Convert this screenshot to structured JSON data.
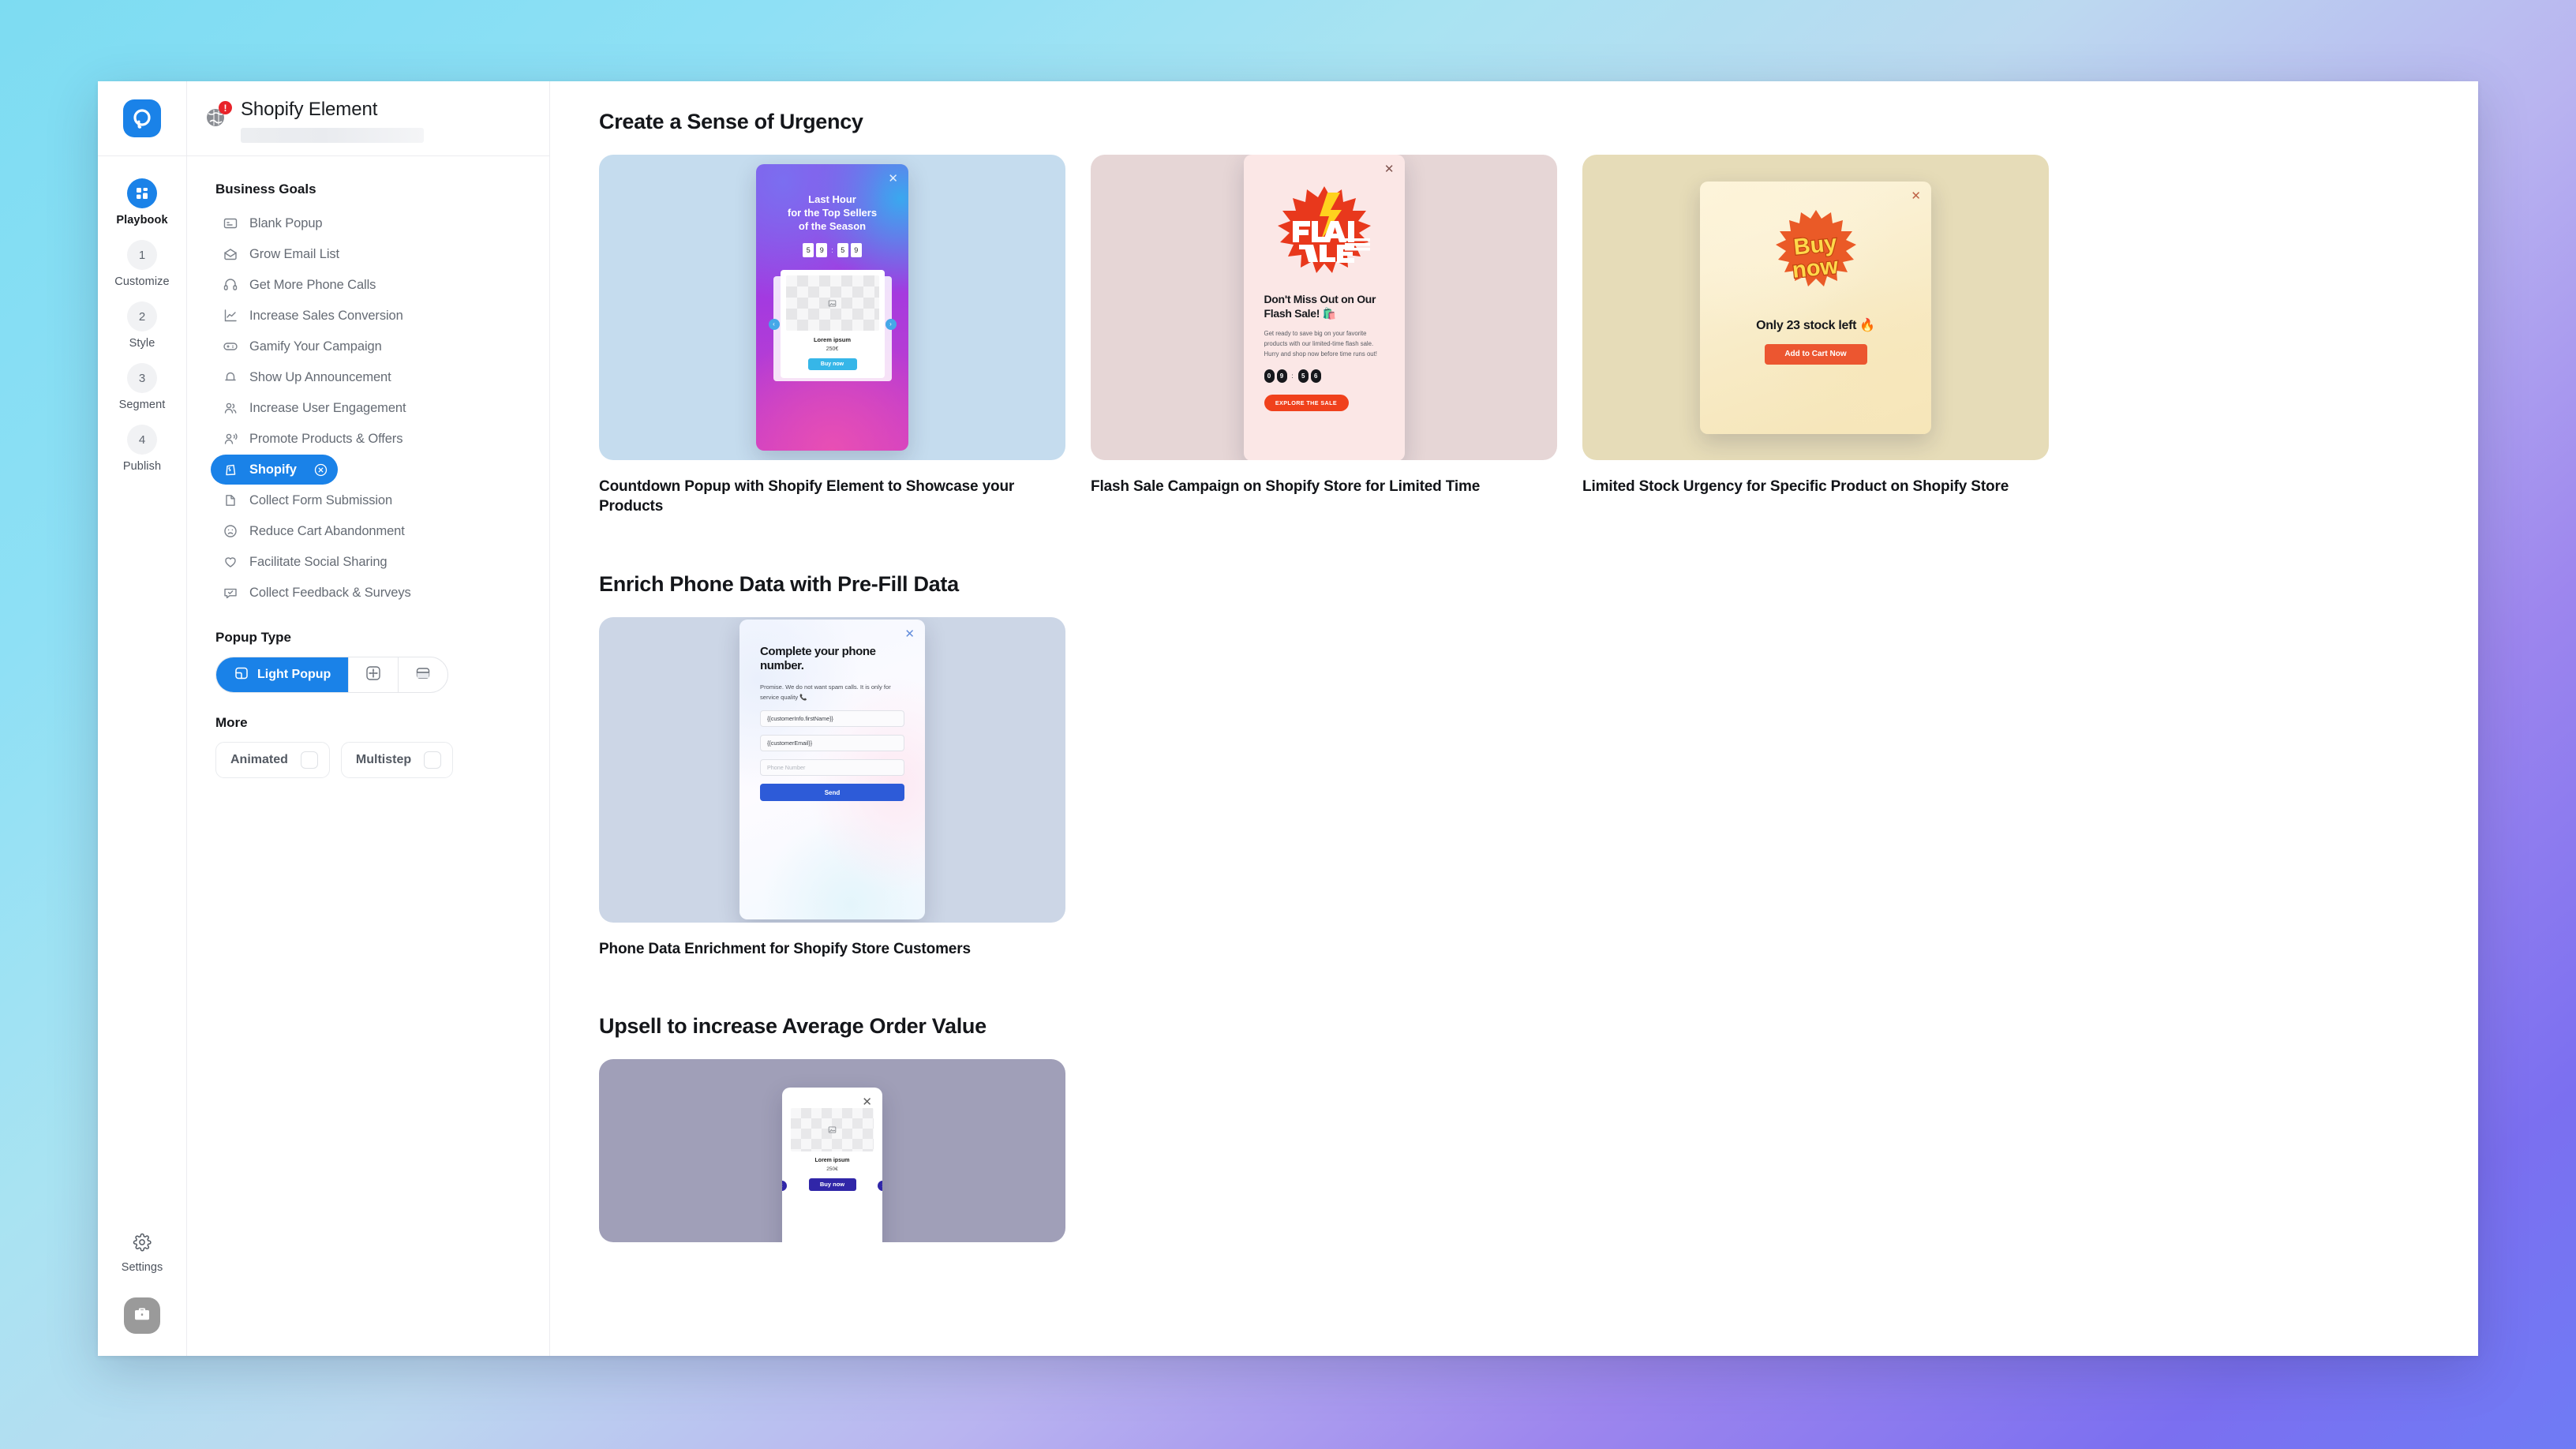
{
  "window": {
    "title": "Shopify Element"
  },
  "rail": {
    "logo_icon": "popupsmart-logo-icon",
    "steps": [
      {
        "badge": "",
        "label": "Playbook",
        "icon": "grid-icon",
        "active": true
      },
      {
        "badge": "1",
        "label": "Customize",
        "active": false
      },
      {
        "badge": "2",
        "label": "Style",
        "active": false
      },
      {
        "badge": "3",
        "label": "Segment",
        "active": false
      },
      {
        "badge": "4",
        "label": "Publish",
        "active": false
      }
    ],
    "settings_label": "Settings",
    "settings_icon": "gear-icon",
    "avatar_icon": "briefcase-icon"
  },
  "header": {
    "globe_icon": "globe-icon",
    "badge": "!",
    "title": "Shopify Element"
  },
  "sidebar": {
    "business_goals_title": "Business Goals",
    "goals": [
      {
        "label": "Blank Popup",
        "icon": "blank-popup-icon",
        "selected": false
      },
      {
        "label": "Grow Email List",
        "icon": "envelope-icon",
        "selected": false
      },
      {
        "label": "Get More Phone Calls",
        "icon": "headset-icon",
        "selected": false
      },
      {
        "label": "Increase Sales Conversion",
        "icon": "chart-line-icon",
        "selected": false
      },
      {
        "label": "Gamify Your Campaign",
        "icon": "gamepad-icon",
        "selected": false
      },
      {
        "label": "Show Up Announcement",
        "icon": "bell-icon",
        "selected": false
      },
      {
        "label": "Increase User Engagement",
        "icon": "users-icon",
        "selected": false
      },
      {
        "label": "Promote Products & Offers",
        "icon": "megaphone-user-icon",
        "selected": false
      },
      {
        "label": "Shopify",
        "icon": "shopify-bag-icon",
        "selected": true,
        "remove_icon": "circle-x-icon"
      },
      {
        "label": "Collect Form Submission",
        "icon": "document-icon",
        "selected": false
      },
      {
        "label": "Reduce Cart Abandonment",
        "icon": "sad-face-icon",
        "selected": false
      },
      {
        "label": "Facilitate Social Sharing",
        "icon": "heart-icon",
        "selected": false
      },
      {
        "label": "Collect Feedback & Surveys",
        "icon": "comment-check-icon",
        "selected": false
      }
    ],
    "popup_type_title": "Popup Type",
    "popup_types": [
      {
        "label": "Light Popup",
        "icon": "light-popup-icon",
        "active": true
      },
      {
        "label": "",
        "icon": "fullscreen-popup-icon",
        "active": false
      },
      {
        "label": "",
        "icon": "bar-popup-icon",
        "active": false
      }
    ],
    "more_title": "More",
    "more_options": [
      {
        "label": "Animated",
        "checked": false
      },
      {
        "label": "Multistep",
        "checked": false
      }
    ]
  },
  "colors": {
    "accent": "#1a82e8",
    "badge_red": "#e8232a",
    "flash_red": "#f0411c",
    "stock_orange": "#ec5630",
    "send_blue": "#2d5bd8",
    "upsell_purple": "#3026a8"
  },
  "main": {
    "sections": [
      {
        "heading": "Create a Sense of Urgency",
        "cards": [
          {
            "caption": "Countdown Popup with Shopify Element to Showcase your Products",
            "preview": {
              "kind": "countdown",
              "close_icon": "close-icon",
              "title": "Last Hour\nfor the Top Sellers\nof the Season",
              "timer_digits": [
                "5",
                "9",
                "5",
                "9"
              ],
              "timer_separator": ":",
              "product_name": "Lorem ipsum",
              "product_price": "250€",
              "cta": "Buy now",
              "prev_icon": "chevron-left-icon",
              "next_icon": "chevron-right-icon"
            }
          },
          {
            "caption": "Flash Sale Campaign on Shopify Store for Limited Time",
            "preview": {
              "kind": "flash-sale",
              "close_icon": "close-icon",
              "badge_line1": "FLASH",
              "badge_line2": "SALE",
              "heading": "Don't Miss Out on Our Flash Sale! 🛍️",
              "body": "Get ready to save big on your favorite products with our limited-time flash sale. Hurry and shop now before time runs out!",
              "timer_digits": [
                "0",
                "9",
                "5",
                "6"
              ],
              "timer_separator": ":",
              "cta": "EXPLORE THE SALE"
            }
          },
          {
            "caption": "Limited Stock Urgency for Specific Product on Shopify Store",
            "preview": {
              "kind": "limited-stock",
              "close_icon": "close-icon",
              "badge_line1": "Buy",
              "badge_line2": "now",
              "heading": "Only 23 stock left 🔥",
              "cta": "Add to Cart Now"
            }
          }
        ]
      },
      {
        "heading": "Enrich Phone Data with Pre-Fill Data",
        "cards": [
          {
            "caption": "Phone Data Enrichment for Shopify Store Customers",
            "preview": {
              "kind": "phone-prefill",
              "close_icon": "close-icon",
              "heading": "Complete your phone number.",
              "body": "Promise. We do not want spam calls. It is only for service quality 📞",
              "field1": "{{customerInfo.firstName}}",
              "field2": "{{customerEmail}}",
              "field3_placeholder": "Phone Number",
              "cta": "Send"
            }
          }
        ]
      },
      {
        "heading": "Upsell to increase Average Order Value",
        "cards": [
          {
            "caption": "",
            "preview": {
              "kind": "upsell",
              "close_icon": "close-icon",
              "product_name": "Lorem ipsum",
              "product_price": "250€",
              "cta": "Buy now",
              "prev_icon": "chevron-left-icon",
              "next_icon": "chevron-right-icon"
            }
          }
        ]
      }
    ]
  }
}
